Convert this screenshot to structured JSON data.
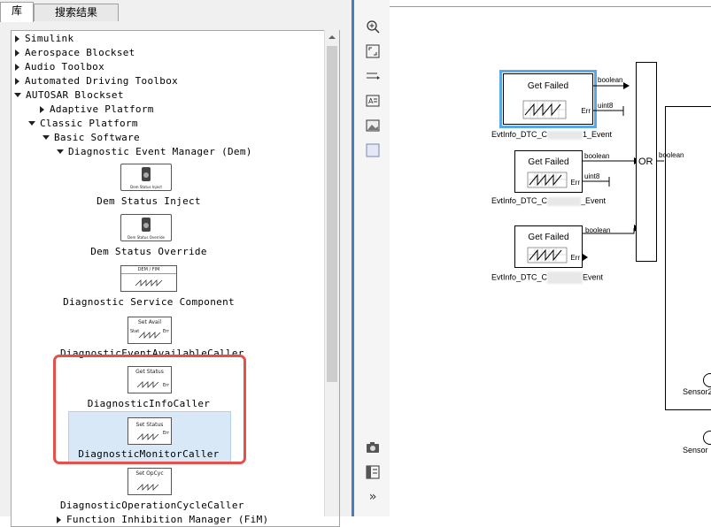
{
  "tabs": [
    {
      "label": "库"
    },
    {
      "label": "搜索结果"
    }
  ],
  "tree": {
    "items": [
      {
        "label": "Simulink",
        "state": "collapsed"
      },
      {
        "label": "Aerospace Blockset",
        "state": "collapsed"
      },
      {
        "label": "Audio Toolbox",
        "state": "collapsed"
      },
      {
        "label": "Automated Driving Toolbox",
        "state": "collapsed"
      },
      {
        "label": "AUTOSAR Blockset",
        "state": "expanded"
      },
      {
        "label": "Adaptive Platform",
        "state": "collapsed"
      },
      {
        "label": "Classic Platform",
        "state": "expanded"
      },
      {
        "label": "Basic Software",
        "state": "expanded"
      },
      {
        "label": "Diagnostic Event Manager (Dem)",
        "state": "expanded"
      }
    ],
    "blocks": [
      {
        "label": "Dem Status Inject",
        "thumb": "Dem Status Inject"
      },
      {
        "label": "Dem Status Override",
        "thumb": "Dem Status Override"
      },
      {
        "label": "Diagnostic Service Component",
        "thumb": "DEM / FIM"
      },
      {
        "label": "DiagnosticEventAvailableCaller",
        "thumb": "Set Avail",
        "in": "Stat",
        "out": "Err"
      },
      {
        "label": "DiagnosticInfoCaller",
        "thumb": "Get Status",
        "out": "Err"
      },
      {
        "label": "DiagnosticMonitorCaller",
        "thumb": "Set Status",
        "out": "Err"
      },
      {
        "label": "DiagnosticOperationCycleCaller",
        "thumb": "Set OpCyc"
      }
    ],
    "selected": "DiagnosticMonitorCaller",
    "partial_next": "Function Inhibition Manager (FiM)"
  },
  "toolbar": {
    "icons": [
      "zoom-in-icon",
      "fit-to-view-icon",
      "signal-lines-icon",
      "annotation-icon",
      "image-icon",
      "area-icon",
      "camera-icon",
      "model-browser-icon",
      "expand-icon"
    ]
  },
  "canvas": {
    "blocks": [
      {
        "title": "Get Failed",
        "out1": "boolean",
        "out2": "uint8",
        "err": "Err",
        "caption_pre": "EvtInfo_DTC_C",
        "caption_post": "1_Event",
        "selected": true
      },
      {
        "title": "Get Failed",
        "out1": "boolean",
        "out2": "uint8",
        "err": "Err",
        "caption_pre": "EvtInfo_DTC_C",
        "caption_post": "_Event",
        "selected": false
      },
      {
        "title": "Get Failed",
        "out1": "boolean",
        "err": "Err",
        "caption_pre": "EvtInfo_DTC_C",
        "caption_post": "Event",
        "selected": false
      }
    ],
    "or_block": {
      "label": "OR",
      "out": "boolean"
    },
    "sensors": [
      {
        "label": "Sensor2"
      },
      {
        "label": "Sensor"
      }
    ]
  }
}
